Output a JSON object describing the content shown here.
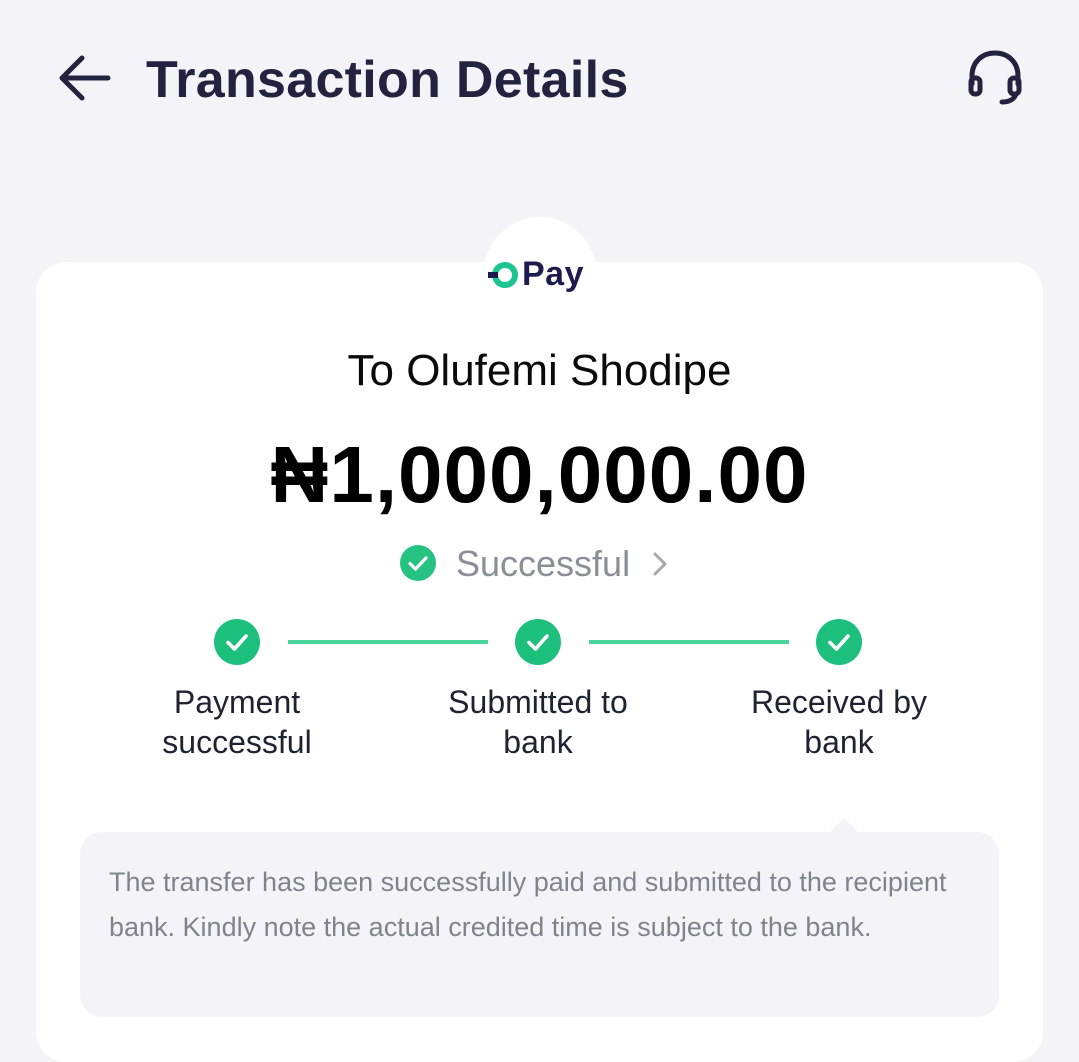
{
  "header": {
    "title": "Transaction Details",
    "back_icon": "arrow-left-icon",
    "support_icon": "headset-icon"
  },
  "logo": {
    "text": "Pay",
    "brand_color": "#1e1b4e",
    "accent_color": "#1dc48f"
  },
  "transaction": {
    "recipient": "To Olufemi Shodipe",
    "amount": "₦1,000,000.00",
    "status": "Successful"
  },
  "steps": [
    {
      "label_line1": "Payment",
      "label_line2": "successful",
      "done": true
    },
    {
      "label_line1": "Submitted to",
      "label_line2": "bank",
      "done": true
    },
    {
      "label_line1": "Received by",
      "label_line2": "bank",
      "done": true
    }
  ],
  "note": {
    "text": "The transfer has been successfully paid and submitted to the recipient bank. Kindly note the actual credited time is subject to the bank."
  },
  "colors": {
    "success": "#26c281",
    "line": "#4dd39c",
    "title": "#24233f",
    "background": "#f4f4f8"
  }
}
